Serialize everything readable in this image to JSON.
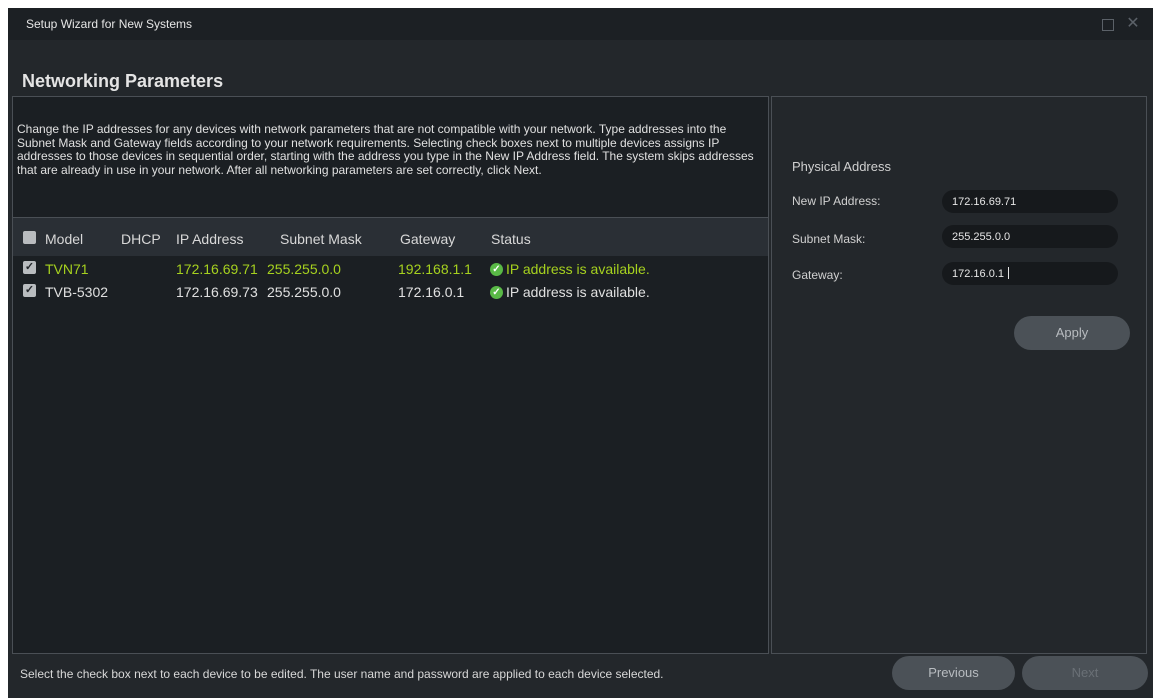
{
  "window": {
    "title": "Setup Wizard for New Systems"
  },
  "page": {
    "heading": "Networking Parameters",
    "description": "Change the IP addresses for any devices with network parameters that are not compatible with your network. Type addresses into the Subnet Mask and Gateway fields according to your network requirements. Selecting check boxes next to multiple devices assigns IP addresses to those devices in sequential order, starting with the address you type in the New IP Address field. The system skips addresses that are already in use in your network. After all networking parameters are set correctly, click Next."
  },
  "table": {
    "columns": [
      "Model",
      "DHCP",
      "IP Address",
      "Subnet Mask",
      "Gateway",
      "Status"
    ],
    "rows": [
      {
        "checked": true,
        "highlighted": true,
        "model": "TVN71",
        "dhcp": "",
        "ip": "172.16.69.71",
        "subnet": "255.255.0.0",
        "gateway": "192.168.1.1",
        "status": "IP address is available."
      },
      {
        "checked": true,
        "highlighted": false,
        "model": "TVB-5302",
        "dhcp": "",
        "ip": "172.16.69.73",
        "subnet": "255.255.0.0",
        "gateway": "172.16.0.1",
        "status": "IP address is available."
      }
    ]
  },
  "form": {
    "physical_address_label": "Physical Address",
    "new_ip_label": "New IP Address:",
    "new_ip_value": "172.16.69.71",
    "subnet_label": "Subnet Mask:",
    "subnet_value": "255.255.0.0",
    "gateway_label": "Gateway:",
    "gateway_value": "172.16.0.1",
    "apply_label": "Apply"
  },
  "footer": {
    "hint": "Select the check box next to each device to be edited. The user name and password are applied to each device selected.",
    "previous_label": "Previous",
    "next_label": "Next"
  },
  "colors": {
    "background": "#23272b",
    "panel": "#1b1f23",
    "highlight_text": "#a6d11f",
    "status_ok": "#59b946"
  },
  "icons": [
    "maximize-icon",
    "close-icon",
    "checkbox-icon",
    "check-circle-icon"
  ]
}
